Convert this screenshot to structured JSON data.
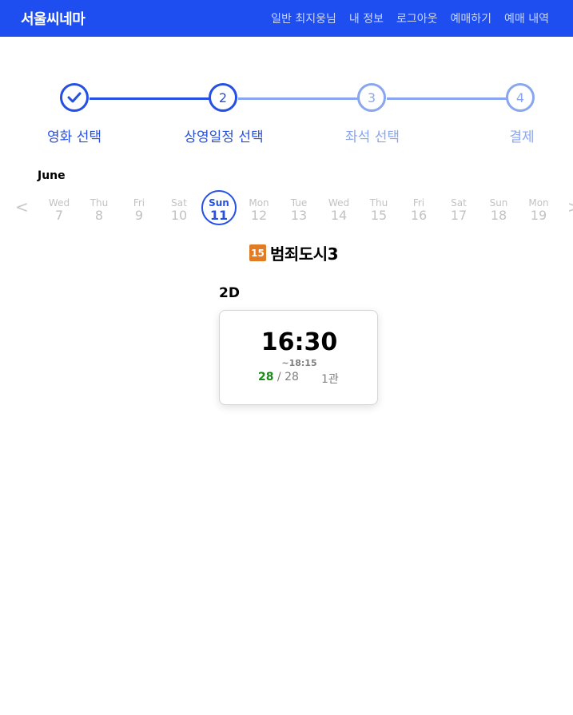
{
  "header": {
    "brand": "서울씨네마",
    "nav": [
      "일반 최지웅님",
      "내 정보",
      "로그아웃",
      "예매하기",
      "예매 내역"
    ],
    "bg_color": "#1f4ef0"
  },
  "stepper": {
    "steps": [
      {
        "number": "",
        "label": "영화 선택",
        "state": "done"
      },
      {
        "number": "2",
        "label": "상영일정 선택",
        "state": "active"
      },
      {
        "number": "3",
        "label": "좌석 선택",
        "state": "todo"
      },
      {
        "number": "4",
        "label": "결제",
        "state": "todo"
      }
    ],
    "active_color": "#2550e3",
    "inactive_color": "#8aa6ef"
  },
  "calendar": {
    "month": "June",
    "prev": "<",
    "next": ">",
    "days": [
      {
        "dow": "Wed",
        "num": "7"
      },
      {
        "dow": "Thu",
        "num": "8"
      },
      {
        "dow": "Fri",
        "num": "9"
      },
      {
        "dow": "Sat",
        "num": "10"
      },
      {
        "dow": "Sun",
        "num": "11"
      },
      {
        "dow": "Mon",
        "num": "12"
      },
      {
        "dow": "Tue",
        "num": "13"
      },
      {
        "dow": "Wed",
        "num": "14"
      },
      {
        "dow": "Thu",
        "num": "15"
      },
      {
        "dow": "Fri",
        "num": "16"
      },
      {
        "dow": "Sat",
        "num": "17"
      },
      {
        "dow": "Sun",
        "num": "18"
      },
      {
        "dow": "Mon",
        "num": "19"
      }
    ],
    "selected": "11"
  },
  "movie": {
    "rating": "15",
    "rating_color": "#e07b26",
    "title": "범죄도시3",
    "format": "2D"
  },
  "showtime": {
    "start": "16:30",
    "end": "~18:15",
    "seats_available": "28",
    "seats_sep": " / ",
    "seats_total": "28",
    "hall": "1관"
  }
}
